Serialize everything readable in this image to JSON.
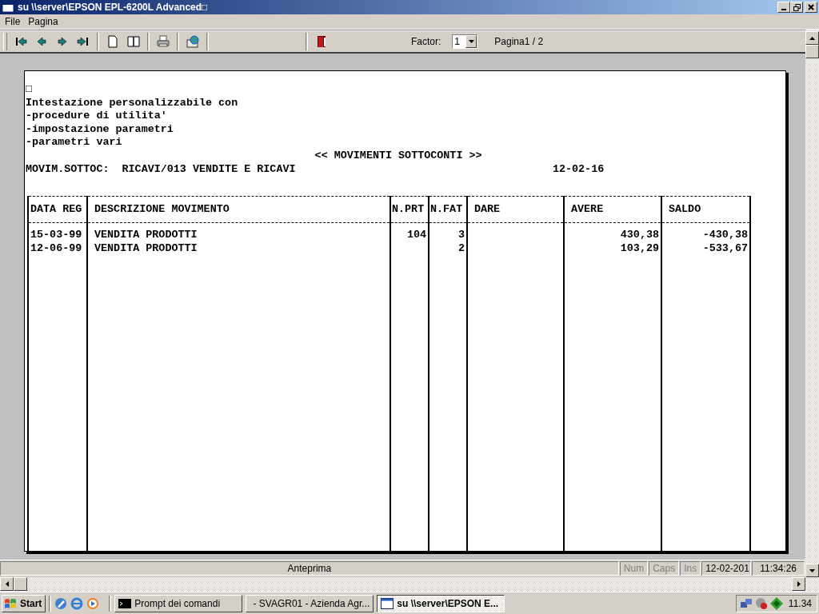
{
  "window": {
    "title": "su \\\\server\\EPSON EPL-6200L Advanced□"
  },
  "menu": [
    "File",
    "Pagina"
  ],
  "toolbar": {
    "factor_label": "Factor:",
    "factor_value": "1",
    "page_indicator": "Pagina1 / 2"
  },
  "report": {
    "header_lines": [
      "□",
      "Intestazione personalizzabile con",
      "-procedure di utilita'",
      "-impostazione parametri",
      "-parametri vari"
    ],
    "title": "<< MOVIMENTI SOTTOCONTI >>",
    "account": "MOVIM.SOTTOC:  RICAVI/013 VENDITE E RICAVI",
    "date": "12-02-16",
    "columns": [
      "DATA REG",
      "DESCRIZIONE MOVIMENTO",
      "N.PRT",
      "N.FAT",
      "DARE",
      "AVERE",
      "SALDO"
    ],
    "rows": [
      [
        "15-03-99",
        "VENDITA PRODOTTI",
        "104",
        "3",
        null,
        "430,38",
        "-430,38"
      ],
      [
        "12-06-99",
        "VENDITA PRODOTTI",
        null,
        "2",
        null,
        "103,29",
        "-533,67"
      ]
    ]
  },
  "status_bar": {
    "message": "Anteprima",
    "indicators": [
      {
        "label": "Num",
        "on": false
      },
      {
        "label": "Caps",
        "on": false
      },
      {
        "label": "Ins",
        "on": false
      }
    ],
    "date": "12-02-201",
    "time": "11:34:26"
  },
  "taskbar": {
    "start": "Start",
    "tasks": [
      {
        "label": "Prompt dei comandi",
        "kind": "console",
        "selected": false
      },
      {
        "label": "- SVAGR01 - Azienda Agr...",
        "kind": "window",
        "selected": false
      },
      {
        "label": "su \\\\server\\EPSON E...",
        "kind": "window",
        "selected": true
      }
    ],
    "clock": "11.34"
  }
}
